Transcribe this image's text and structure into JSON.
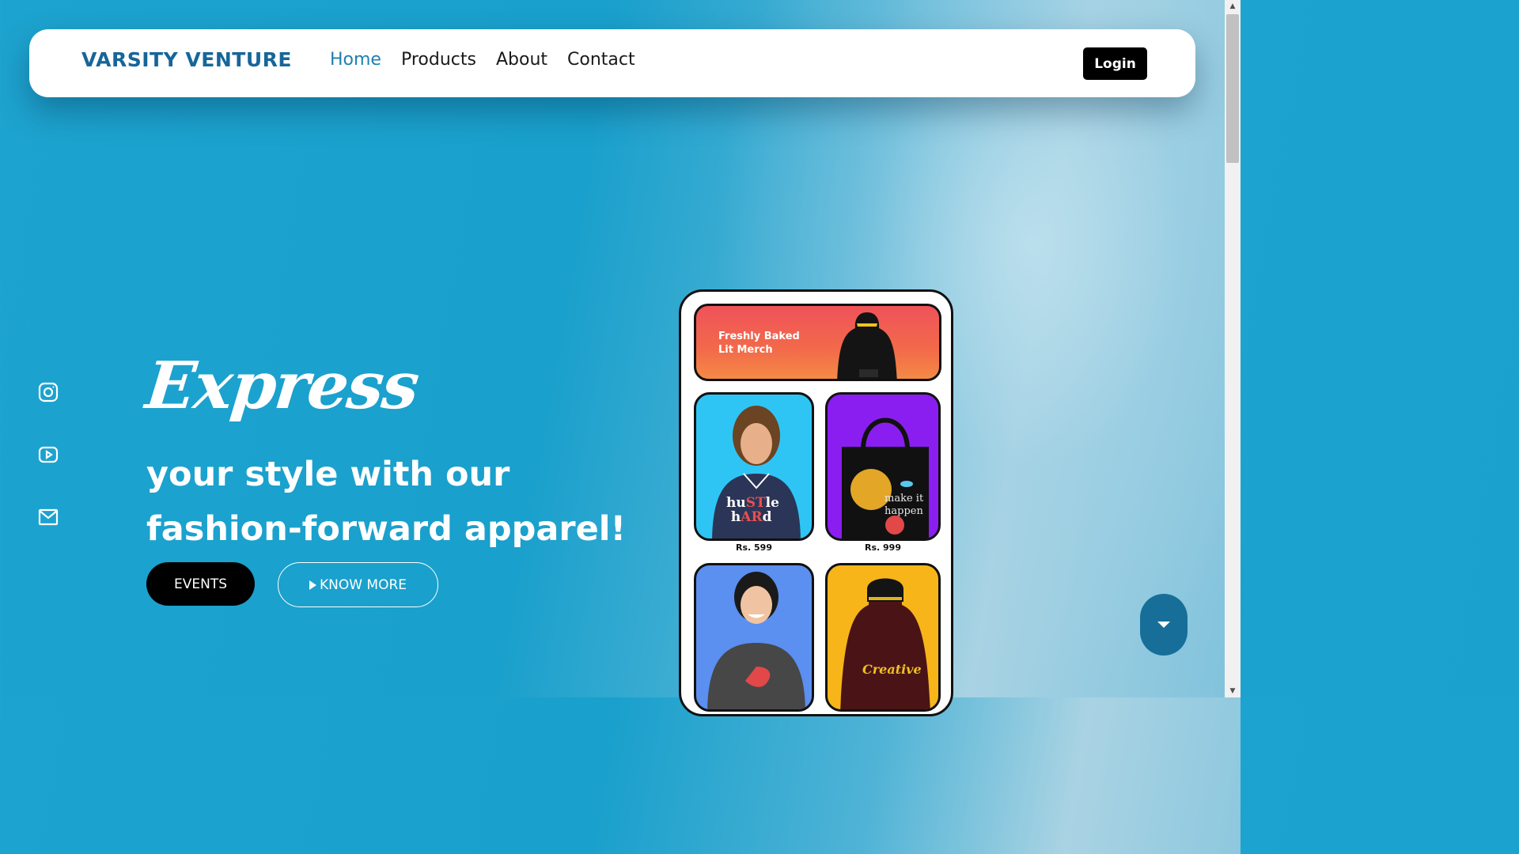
{
  "header": {
    "logo": "VARSITY VENTURE",
    "nav": [
      {
        "label": "Home",
        "active": true
      },
      {
        "label": "Products"
      },
      {
        "label": "About"
      },
      {
        "label": "Contact"
      }
    ],
    "login_label": "Login"
  },
  "social": [
    "instagram-icon",
    "youtube-icon",
    "mail-icon"
  ],
  "hero": {
    "headline": "Express",
    "tagline_line1": "your style with our",
    "tagline_line2": "fashion-forward apparel!",
    "events_label": "EVENTS",
    "know_more_label": "KNOW MORE"
  },
  "phone": {
    "banner_line1": "Freshly Baked",
    "banner_line2": "Lit Merch",
    "products": [
      {
        "price": "Rs. 599",
        "print": "hustle hard",
        "bg": "#2ec5f5"
      },
      {
        "price": "Rs. 999",
        "print": "make it happen",
        "bg": "#8a1ef0"
      },
      {
        "print": "",
        "bg": "#5b8ff0"
      },
      {
        "print": "Creative",
        "bg": "#f7b51a"
      }
    ]
  },
  "colors": {
    "brand": "#17669a",
    "active_nav": "#1f7fb0",
    "fab": "#176f99"
  }
}
